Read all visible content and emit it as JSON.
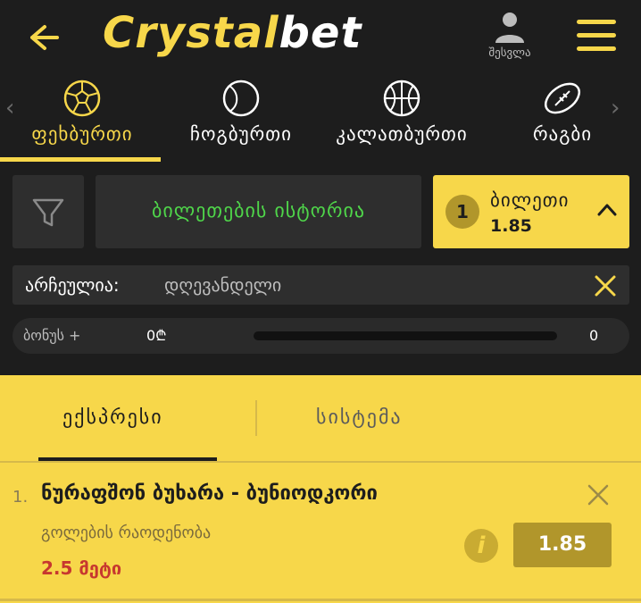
{
  "header": {
    "logo_part1": "Crystal",
    "logo_part2": "bet",
    "login_label": "შესვლა"
  },
  "sports": [
    {
      "label": "ფეხბურთი",
      "icon": "soccer-ball-icon"
    },
    {
      "label": "ჩოგბურთი",
      "icon": "tennis-ball-icon"
    },
    {
      "label": "კალათბურთი",
      "icon": "basketball-icon"
    },
    {
      "label": "რაგბი",
      "icon": "rugby-ball-icon"
    }
  ],
  "controls": {
    "history_label": "ბილეთების ისტორია",
    "ticket_count": "1",
    "ticket_title": "ბილეთი",
    "ticket_odd": "1.85"
  },
  "selected": {
    "label": "არჩეულია:",
    "value": "დღევანდელი"
  },
  "bonus": {
    "label": "ბონუს +",
    "amount": "0₾",
    "count": "0",
    "progress": 0
  },
  "tabs": [
    {
      "label": "ექსპრესი",
      "active": true
    },
    {
      "label": "სისტემა",
      "active": false
    }
  ],
  "bet": {
    "index": "1.",
    "match": "ნურაფშონ ბუხარა - ბუნიოდკორი",
    "market": "გოლების რაოდენობა",
    "pick": "2.5 მეტი",
    "odd": "1.85",
    "info_glyph": "i"
  },
  "colors": {
    "accent": "#f7d74a",
    "dark": "#1d1d1d",
    "panel": "#2e2e2e",
    "green": "#4fd64a",
    "red": "#c7372f"
  }
}
